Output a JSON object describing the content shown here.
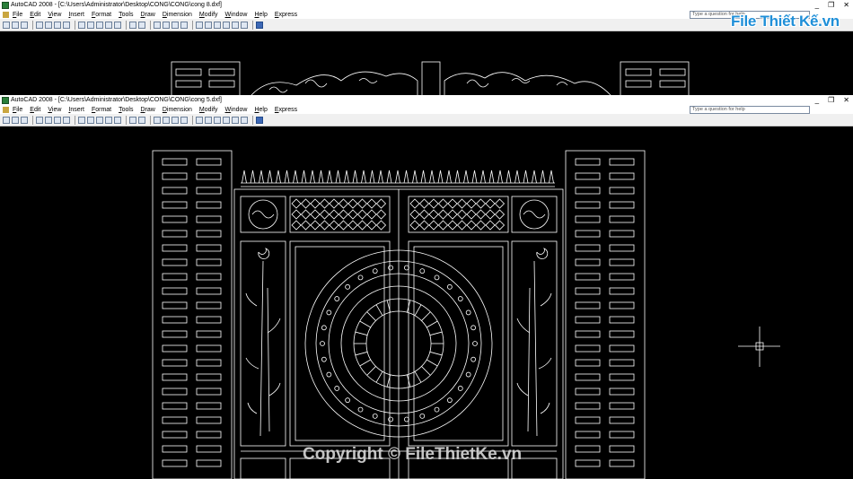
{
  "back_window": {
    "title": "AutoCAD 2008 - [C:\\Users\\Administrator\\Desktop\\CONG\\CONG\\cong 8.dxf]",
    "menu": [
      "File",
      "Edit",
      "View",
      "Insert",
      "Format",
      "Tools",
      "Draw",
      "Dimension",
      "Modify",
      "Window",
      "Help",
      "Express"
    ],
    "help_placeholder": "Type a question for help"
  },
  "front_window": {
    "title": "AutoCAD 2008 - [C:\\Users\\Administrator\\Desktop\\CONG\\CONG\\cong 5.dxf]",
    "menu": [
      "File",
      "Edit",
      "View",
      "Insert",
      "Format",
      "Tools",
      "Draw",
      "Dimension",
      "Modify",
      "Window",
      "Help",
      "Express"
    ],
    "help_placeholder": "Type a question for help"
  },
  "window_controls": {
    "minimize": "_",
    "restore": "❐",
    "close": "✕"
  },
  "logo": {
    "text": "File Thiết Kế.vn"
  },
  "watermark": {
    "text": "Copyright © FileThietKe.vn"
  },
  "colors": {
    "canvas": "#000000",
    "drawing_lines": "#ffffff",
    "toolbar": "#f0f0f0",
    "logo_blue": "#1f8fd8"
  },
  "icons": {
    "app": "autocad-app-icon",
    "crosshair": "crosshair-cursor-icon"
  }
}
